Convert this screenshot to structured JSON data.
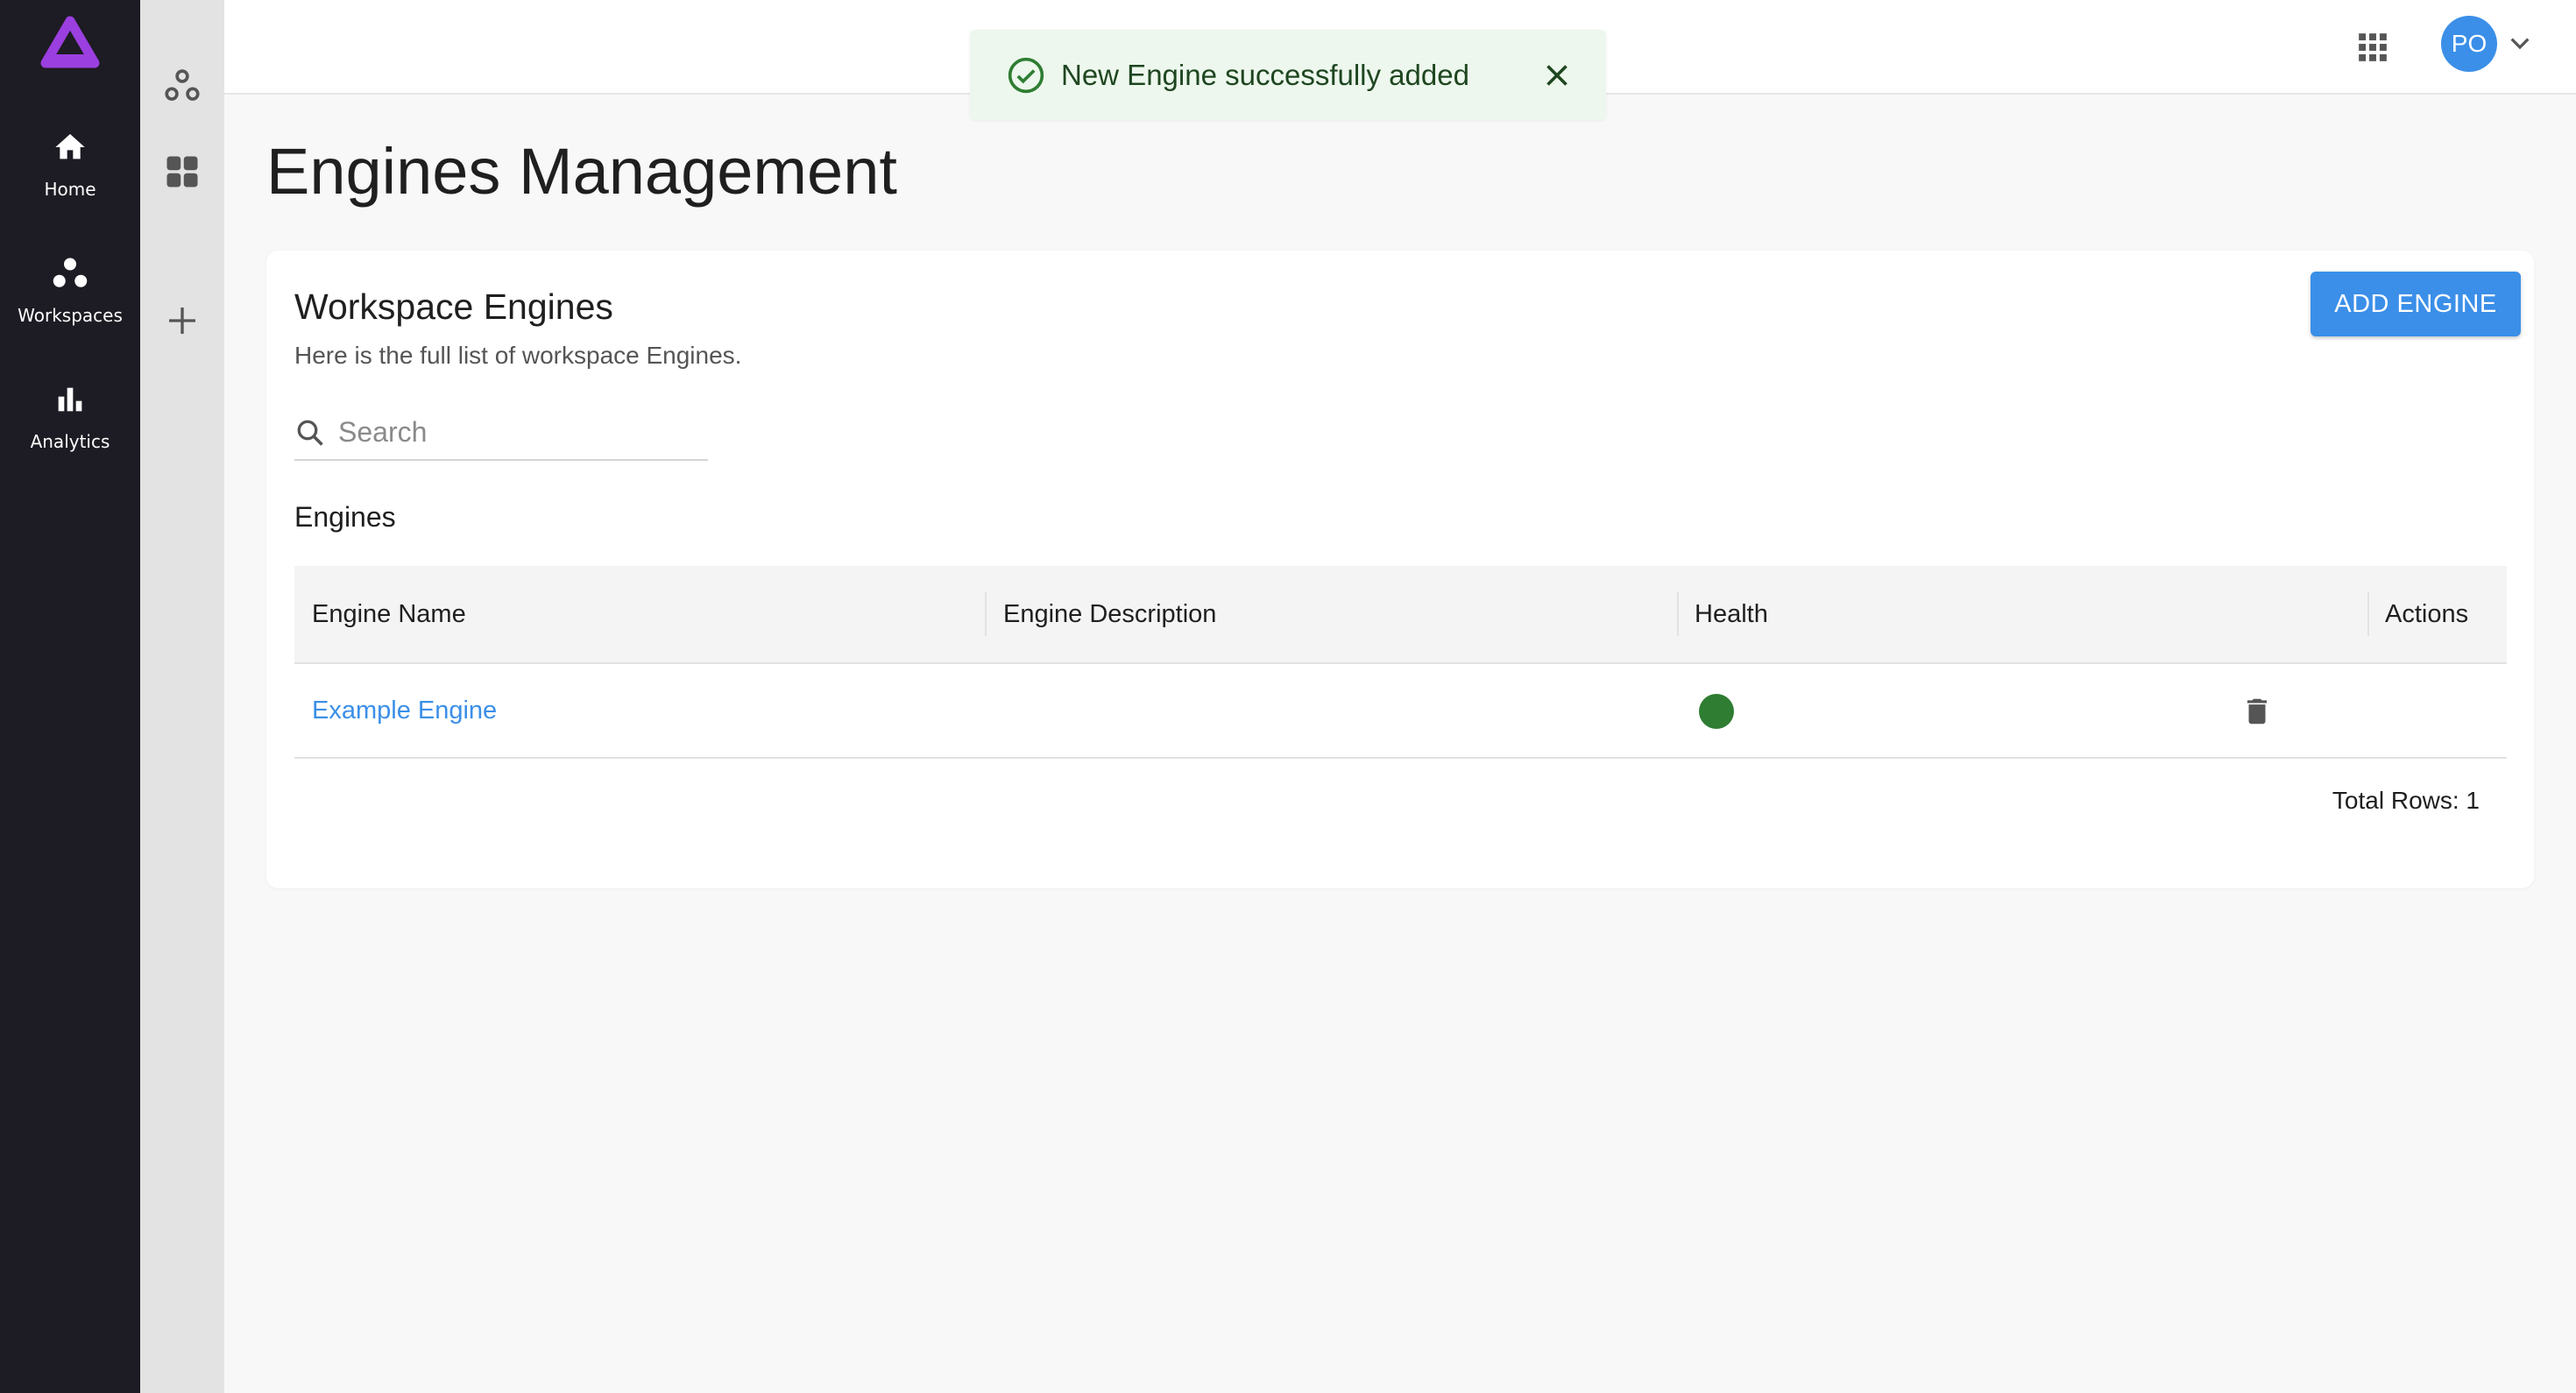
{
  "colors": {
    "rail": "#1d1b23",
    "subrail": "#e3e3e3",
    "accent": "#3b8fe8",
    "logo": "#9b3fe0",
    "toast_bg": "#edf7ed",
    "toast_text": "#1e4620",
    "toast_icon": "#2e7d32",
    "health_ok": "#2e7d32"
  },
  "rail": {
    "logo_icon": "triangle-logo-icon",
    "items": [
      {
        "label": "Home",
        "icon": "home-icon"
      },
      {
        "label": "Workspaces",
        "icon": "workspaces-icon"
      },
      {
        "label": "Analytics",
        "icon": "bar-chart-icon"
      }
    ]
  },
  "subrail": {
    "icons": [
      "workspace-nodes-icon",
      "grid-view-icon",
      "plus-icon"
    ]
  },
  "topbar": {
    "apps_icon": "apps-grid-icon",
    "avatar_initials": "PO",
    "menu_icon": "chevron-down-icon"
  },
  "toast": {
    "message": "New Engine successfully added",
    "icon": "check-circle-icon",
    "close_icon": "close-icon"
  },
  "page": {
    "title": "Engines Management"
  },
  "card": {
    "title": "Workspace Engines",
    "subtitle": "Here is the full list of workspace Engines.",
    "add_button": "ADD ENGINE",
    "search": {
      "placeholder": "Search",
      "value": ""
    },
    "section_label": "Engines",
    "table": {
      "columns": [
        "Engine Name",
        "Engine Description",
        "Health",
        "Actions"
      ],
      "rows": [
        {
          "name": "Example Engine",
          "description": "",
          "health": "healthy",
          "action_icon": "trash-icon"
        }
      ]
    },
    "total_rows": "Total Rows: 1"
  }
}
